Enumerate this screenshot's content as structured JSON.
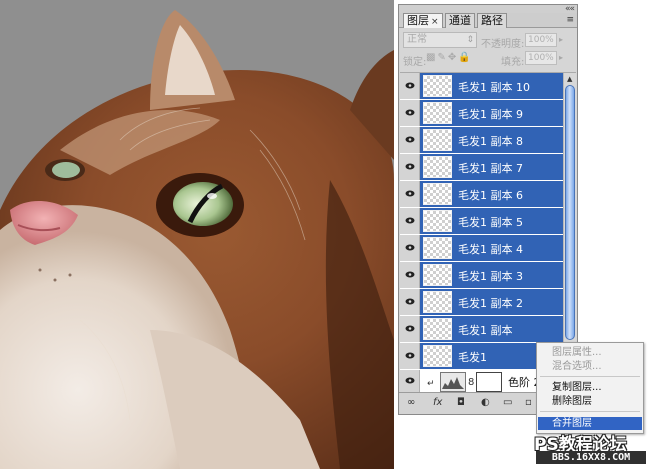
{
  "tabs": [
    {
      "label": "图层",
      "close": "×"
    },
    {
      "label": "通道"
    },
    {
      "label": "路径"
    }
  ],
  "panel_controls": {
    "double_arrow": "««",
    "menu_icon": "≡"
  },
  "options": {
    "blend_mode": "正常",
    "opacity_label": "不透明度:",
    "opacity_value": "100%",
    "lock_label": "锁定:",
    "fill_label": "填充:",
    "fill_value": "100%"
  },
  "layers": [
    {
      "name": "毛发1 副本 10",
      "selected": true
    },
    {
      "name": "毛发1 副本 9",
      "selected": true
    },
    {
      "name": "毛发1 副本 8",
      "selected": true
    },
    {
      "name": "毛发1 副本 7",
      "selected": true
    },
    {
      "name": "毛发1 副本 6",
      "selected": true
    },
    {
      "name": "毛发1 副本 5",
      "selected": true
    },
    {
      "name": "毛发1 副本 4",
      "selected": true
    },
    {
      "name": "毛发1 副本 3",
      "selected": true
    },
    {
      "name": "毛发1 副本 2",
      "selected": true
    },
    {
      "name": "毛发1 副本",
      "selected": true
    },
    {
      "name": "毛发1",
      "selected": true
    },
    {
      "name": "色阶 2",
      "selected": false,
      "adjustment": true
    }
  ],
  "context_menu": {
    "items": [
      {
        "label": "图层属性...",
        "state": "disabled"
      },
      {
        "label": "混合选项...",
        "state": "disabled"
      },
      {
        "label": "复制图层...",
        "state": "normal"
      },
      {
        "label": "删除图层",
        "state": "normal"
      },
      {
        "label": "合并图层",
        "state": "selected"
      }
    ]
  },
  "bottom_icons": [
    "link-icon",
    "fx-icon",
    "mask-icon",
    "adjustment-icon",
    "group-icon",
    "new-layer-icon",
    "trash-icon"
  ],
  "bottom_labels": {
    "link": "∞",
    "fx": "fx",
    "mask": "◘",
    "adjust": "◐",
    "group": "▭",
    "new": "▫",
    "trash": "🗑"
  },
  "watermark": {
    "title": "PS教程论坛",
    "url": "BBS.16XX8.COM"
  },
  "colors": {
    "selection": "#3163b5",
    "menu_highlight": "#3164c4",
    "panel": "#d6d6d6"
  }
}
